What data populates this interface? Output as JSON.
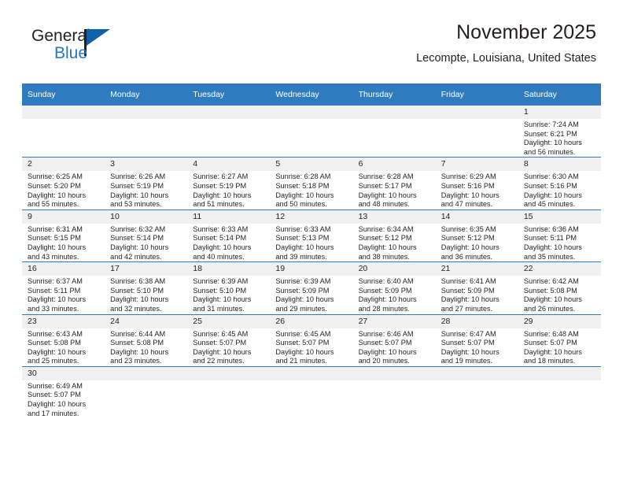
{
  "logo": {
    "text_top": "General",
    "text_bottom": "Blue",
    "accent_color": "#1161a8"
  },
  "header": {
    "title": "November 2025",
    "subtitle": "Lecompte, Louisiana, United States"
  },
  "calendar": {
    "header_color": "#2f7bbf",
    "weekdays": [
      "Sunday",
      "Monday",
      "Tuesday",
      "Wednesday",
      "Thursday",
      "Friday",
      "Saturday"
    ],
    "weeks": [
      [
        {
          "day": "",
          "sunrise": "",
          "sunset": "",
          "daylight1": "",
          "daylight2": ""
        },
        {
          "day": "",
          "sunrise": "",
          "sunset": "",
          "daylight1": "",
          "daylight2": ""
        },
        {
          "day": "",
          "sunrise": "",
          "sunset": "",
          "daylight1": "",
          "daylight2": ""
        },
        {
          "day": "",
          "sunrise": "",
          "sunset": "",
          "daylight1": "",
          "daylight2": ""
        },
        {
          "day": "",
          "sunrise": "",
          "sunset": "",
          "daylight1": "",
          "daylight2": ""
        },
        {
          "day": "",
          "sunrise": "",
          "sunset": "",
          "daylight1": "",
          "daylight2": ""
        },
        {
          "day": "1",
          "sunrise": "Sunrise: 7:24 AM",
          "sunset": "Sunset: 6:21 PM",
          "daylight1": "Daylight: 10 hours",
          "daylight2": "and 56 minutes."
        }
      ],
      [
        {
          "day": "2",
          "sunrise": "Sunrise: 6:25 AM",
          "sunset": "Sunset: 5:20 PM",
          "daylight1": "Daylight: 10 hours",
          "daylight2": "and 55 minutes."
        },
        {
          "day": "3",
          "sunrise": "Sunrise: 6:26 AM",
          "sunset": "Sunset: 5:19 PM",
          "daylight1": "Daylight: 10 hours",
          "daylight2": "and 53 minutes."
        },
        {
          "day": "4",
          "sunrise": "Sunrise: 6:27 AM",
          "sunset": "Sunset: 5:19 PM",
          "daylight1": "Daylight: 10 hours",
          "daylight2": "and 51 minutes."
        },
        {
          "day": "5",
          "sunrise": "Sunrise: 6:28 AM",
          "sunset": "Sunset: 5:18 PM",
          "daylight1": "Daylight: 10 hours",
          "daylight2": "and 50 minutes."
        },
        {
          "day": "6",
          "sunrise": "Sunrise: 6:28 AM",
          "sunset": "Sunset: 5:17 PM",
          "daylight1": "Daylight: 10 hours",
          "daylight2": "and 48 minutes."
        },
        {
          "day": "7",
          "sunrise": "Sunrise: 6:29 AM",
          "sunset": "Sunset: 5:16 PM",
          "daylight1": "Daylight: 10 hours",
          "daylight2": "and 47 minutes."
        },
        {
          "day": "8",
          "sunrise": "Sunrise: 6:30 AM",
          "sunset": "Sunset: 5:16 PM",
          "daylight1": "Daylight: 10 hours",
          "daylight2": "and 45 minutes."
        }
      ],
      [
        {
          "day": "9",
          "sunrise": "Sunrise: 6:31 AM",
          "sunset": "Sunset: 5:15 PM",
          "daylight1": "Daylight: 10 hours",
          "daylight2": "and 43 minutes."
        },
        {
          "day": "10",
          "sunrise": "Sunrise: 6:32 AM",
          "sunset": "Sunset: 5:14 PM",
          "daylight1": "Daylight: 10 hours",
          "daylight2": "and 42 minutes."
        },
        {
          "day": "11",
          "sunrise": "Sunrise: 6:33 AM",
          "sunset": "Sunset: 5:14 PM",
          "daylight1": "Daylight: 10 hours",
          "daylight2": "and 40 minutes."
        },
        {
          "day": "12",
          "sunrise": "Sunrise: 6:33 AM",
          "sunset": "Sunset: 5:13 PM",
          "daylight1": "Daylight: 10 hours",
          "daylight2": "and 39 minutes."
        },
        {
          "day": "13",
          "sunrise": "Sunrise: 6:34 AM",
          "sunset": "Sunset: 5:12 PM",
          "daylight1": "Daylight: 10 hours",
          "daylight2": "and 38 minutes."
        },
        {
          "day": "14",
          "sunrise": "Sunrise: 6:35 AM",
          "sunset": "Sunset: 5:12 PM",
          "daylight1": "Daylight: 10 hours",
          "daylight2": "and 36 minutes."
        },
        {
          "day": "15",
          "sunrise": "Sunrise: 6:36 AM",
          "sunset": "Sunset: 5:11 PM",
          "daylight1": "Daylight: 10 hours",
          "daylight2": "and 35 minutes."
        }
      ],
      [
        {
          "day": "16",
          "sunrise": "Sunrise: 6:37 AM",
          "sunset": "Sunset: 5:11 PM",
          "daylight1": "Daylight: 10 hours",
          "daylight2": "and 33 minutes."
        },
        {
          "day": "17",
          "sunrise": "Sunrise: 6:38 AM",
          "sunset": "Sunset: 5:10 PM",
          "daylight1": "Daylight: 10 hours",
          "daylight2": "and 32 minutes."
        },
        {
          "day": "18",
          "sunrise": "Sunrise: 6:39 AM",
          "sunset": "Sunset: 5:10 PM",
          "daylight1": "Daylight: 10 hours",
          "daylight2": "and 31 minutes."
        },
        {
          "day": "19",
          "sunrise": "Sunrise: 6:39 AM",
          "sunset": "Sunset: 5:09 PM",
          "daylight1": "Daylight: 10 hours",
          "daylight2": "and 29 minutes."
        },
        {
          "day": "20",
          "sunrise": "Sunrise: 6:40 AM",
          "sunset": "Sunset: 5:09 PM",
          "daylight1": "Daylight: 10 hours",
          "daylight2": "and 28 minutes."
        },
        {
          "day": "21",
          "sunrise": "Sunrise: 6:41 AM",
          "sunset": "Sunset: 5:09 PM",
          "daylight1": "Daylight: 10 hours",
          "daylight2": "and 27 minutes."
        },
        {
          "day": "22",
          "sunrise": "Sunrise: 6:42 AM",
          "sunset": "Sunset: 5:08 PM",
          "daylight1": "Daylight: 10 hours",
          "daylight2": "and 26 minutes."
        }
      ],
      [
        {
          "day": "23",
          "sunrise": "Sunrise: 6:43 AM",
          "sunset": "Sunset: 5:08 PM",
          "daylight1": "Daylight: 10 hours",
          "daylight2": "and 25 minutes."
        },
        {
          "day": "24",
          "sunrise": "Sunrise: 6:44 AM",
          "sunset": "Sunset: 5:08 PM",
          "daylight1": "Daylight: 10 hours",
          "daylight2": "and 23 minutes."
        },
        {
          "day": "25",
          "sunrise": "Sunrise: 6:45 AM",
          "sunset": "Sunset: 5:07 PM",
          "daylight1": "Daylight: 10 hours",
          "daylight2": "and 22 minutes."
        },
        {
          "day": "26",
          "sunrise": "Sunrise: 6:45 AM",
          "sunset": "Sunset: 5:07 PM",
          "daylight1": "Daylight: 10 hours",
          "daylight2": "and 21 minutes."
        },
        {
          "day": "27",
          "sunrise": "Sunrise: 6:46 AM",
          "sunset": "Sunset: 5:07 PM",
          "daylight1": "Daylight: 10 hours",
          "daylight2": "and 20 minutes."
        },
        {
          "day": "28",
          "sunrise": "Sunrise: 6:47 AM",
          "sunset": "Sunset: 5:07 PM",
          "daylight1": "Daylight: 10 hours",
          "daylight2": "and 19 minutes."
        },
        {
          "day": "29",
          "sunrise": "Sunrise: 6:48 AM",
          "sunset": "Sunset: 5:07 PM",
          "daylight1": "Daylight: 10 hours",
          "daylight2": "and 18 minutes."
        }
      ],
      [
        {
          "day": "30",
          "sunrise": "Sunrise: 6:49 AM",
          "sunset": "Sunset: 5:07 PM",
          "daylight1": "Daylight: 10 hours",
          "daylight2": "and 17 minutes."
        },
        {
          "day": "",
          "sunrise": "",
          "sunset": "",
          "daylight1": "",
          "daylight2": ""
        },
        {
          "day": "",
          "sunrise": "",
          "sunset": "",
          "daylight1": "",
          "daylight2": ""
        },
        {
          "day": "",
          "sunrise": "",
          "sunset": "",
          "daylight1": "",
          "daylight2": ""
        },
        {
          "day": "",
          "sunrise": "",
          "sunset": "",
          "daylight1": "",
          "daylight2": ""
        },
        {
          "day": "",
          "sunrise": "",
          "sunset": "",
          "daylight1": "",
          "daylight2": ""
        },
        {
          "day": "",
          "sunrise": "",
          "sunset": "",
          "daylight1": "",
          "daylight2": ""
        }
      ]
    ]
  }
}
